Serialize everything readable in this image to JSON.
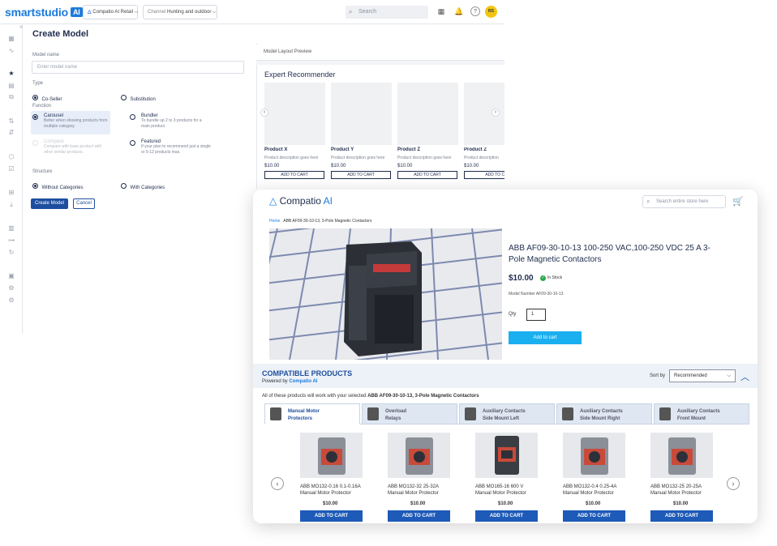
{
  "app": {
    "logo_main": "smartstudio",
    "logo_badge": "AI",
    "brand_chip": "Compatio AI Retail",
    "channel_label": "Channel",
    "channel_value": "Hunting and outdoor",
    "search_placeholder": "Search",
    "avatar_initials": "RS"
  },
  "form": {
    "title": "Create Model",
    "model_name_label": "Model name",
    "model_name_placeholder": "Enter model name",
    "type_label": "Type",
    "type_options": [
      "Co-Seller",
      "Substitution"
    ],
    "function_label": "Function",
    "functions": [
      {
        "name": "Carousel",
        "desc": "Better when showing products from multiple category."
      },
      {
        "name": "Bundler",
        "desc": "To bundle up 2 to 3 products for a main product."
      },
      {
        "name": "Compare",
        "desc": "Compare with base product with other similar products."
      },
      {
        "name": "Featured",
        "desc": "If your plan to recommend just a single or 5-12 products max."
      }
    ],
    "structure_label": "Structure",
    "structure_options": [
      "Without Categories",
      "With Categories"
    ],
    "create_button": "Create Model",
    "cancel_button": "Cancel"
  },
  "preview": {
    "header": "Model Layout Preview",
    "title": "Expert Recommender",
    "products": [
      {
        "name": "Product X",
        "desc": "Product description goes here",
        "price": "$10.00",
        "button": "ADD TO CART"
      },
      {
        "name": "Product Y",
        "desc": "Product description goes here",
        "price": "$10.00",
        "button": "ADD TO CART"
      },
      {
        "name": "Product Z",
        "desc": "Product description goes here",
        "price": "$10.00",
        "button": "ADD TO CART"
      },
      {
        "name": "Product Z",
        "desc": "Product description",
        "price": "$10.00",
        "button": "ADD TO CAR"
      }
    ]
  },
  "store": {
    "logo": "Compatio",
    "logo_ai": "AI",
    "search_placeholder": "Search entire store here",
    "breadcrumb_home": "Home",
    "breadcrumb_item": "ABB AF09-30-10-13, 3-Pole Magnetic Contactors",
    "product_title": "ABB AF09-30-10-13 100-250 VAC,100-250 VDC 25 A 3-Pole Magnetic Contactors",
    "price": "$10.00",
    "stock": "In Stock",
    "model_number": "Model Number AF09-30-10-13",
    "qty_label": "Qty",
    "qty_value": "1",
    "add_to_cart": "Add to cart",
    "compat_title": "COMPATIBLE PRODUCTS",
    "powered_by": "Powered by",
    "powered_brand": "Compatio AI",
    "sort_label": "Sort by",
    "sort_value": "Recommended",
    "note_prefix": "All of these products will work with your selected",
    "note_product": "ABB AF09-30-10-13, 3-Pole Magnetic Contactors",
    "tabs": [
      {
        "line1": "Manual Motor",
        "line2": "Protectors"
      },
      {
        "line1": "Overload",
        "line2": "Relays"
      },
      {
        "line1": "Auxiliary Contacts",
        "line2": "Side Mount Left"
      },
      {
        "line1": "Auxiliary Contacts",
        "line2": "Side Mount Right"
      },
      {
        "line1": "Auxiliary Contacts",
        "line2": "Front Mount"
      }
    ],
    "products": [
      {
        "line1": "ABB MO132-0.16 0.1-0.16A",
        "line2": "Manual Motor Protector",
        "price": "$10.00",
        "button": "ADD TO CART"
      },
      {
        "line1": "ABB MO132-32 25-32A",
        "line2": "Manual Motor Protector",
        "price": "$10.00",
        "button": "ADD TO CART"
      },
      {
        "line1": "ABB MO165-16 600 V",
        "line2": "Manual Motor Protector",
        "price": "$10.00",
        "button": "ADD TO CART"
      },
      {
        "line1": "ABB MO132-0.4 0.25-4A",
        "line2": "Manual Motor Protector",
        "price": "$10.00",
        "button": "ADD TO CART"
      },
      {
        "line1": "ABB MO132-25 20-25A",
        "line2": "Manual Motor Protector",
        "price": "$10.00",
        "button": "ADD TO CART"
      }
    ]
  }
}
